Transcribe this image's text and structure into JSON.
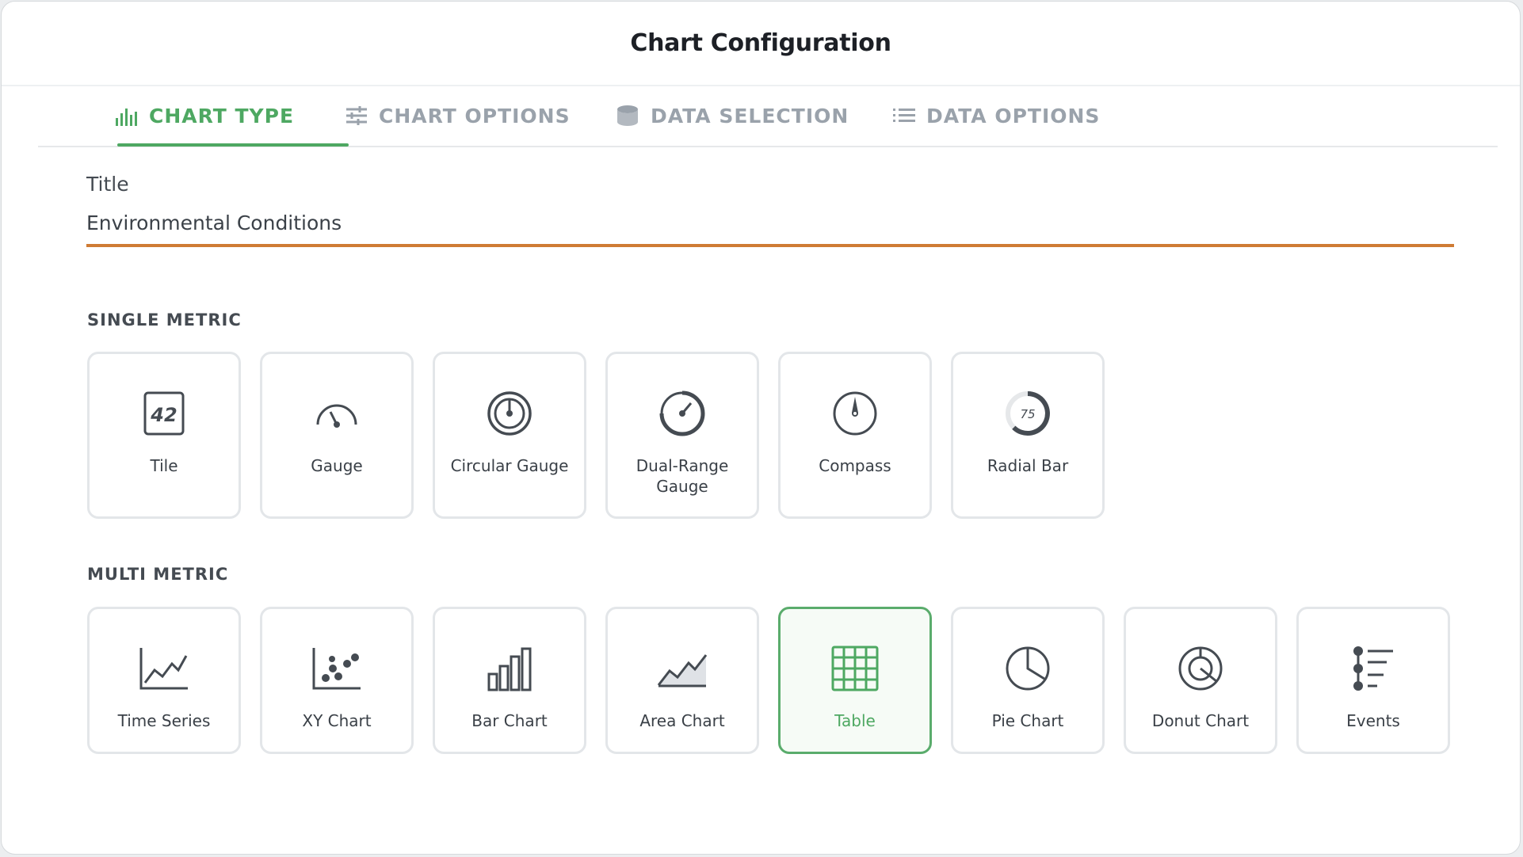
{
  "header": {
    "title": "Chart Configuration"
  },
  "tabs": [
    {
      "label": "CHART TYPE",
      "icon": "bar-chart-icon",
      "active": true
    },
    {
      "label": "CHART OPTIONS",
      "icon": "sliders-icon",
      "active": false
    },
    {
      "label": "DATA SELECTION",
      "icon": "database-icon",
      "active": false
    },
    {
      "label": "DATA OPTIONS",
      "icon": "list-icon",
      "active": false
    }
  ],
  "title_field": {
    "label": "Title",
    "value": "Environmental Conditions"
  },
  "single_metric": {
    "heading": "SINGLE METRIC",
    "cards": [
      {
        "label": "Tile",
        "icon": "tile-icon",
        "tile_value": "42"
      },
      {
        "label": "Gauge",
        "icon": "gauge-icon"
      },
      {
        "label": "Circular Gauge",
        "icon": "circular-gauge-icon"
      },
      {
        "label": "Dual-Range Gauge",
        "icon": "dual-range-gauge-icon"
      },
      {
        "label": "Compass",
        "icon": "compass-icon"
      },
      {
        "label": "Radial Bar",
        "icon": "radial-bar-icon",
        "radial_value": "75"
      }
    ]
  },
  "multi_metric": {
    "heading": "MULTI METRIC",
    "cards": [
      {
        "label": "Time Series",
        "icon": "time-series-icon"
      },
      {
        "label": "XY Chart",
        "icon": "xy-chart-icon"
      },
      {
        "label": "Bar Chart",
        "icon": "bar-chart-icon"
      },
      {
        "label": "Area Chart",
        "icon": "area-chart-icon"
      },
      {
        "label": "Table",
        "icon": "table-icon",
        "selected": true
      },
      {
        "label": "Pie Chart",
        "icon": "pie-chart-icon"
      },
      {
        "label": "Donut Chart",
        "icon": "donut-chart-icon"
      },
      {
        "label": "Events",
        "icon": "events-icon"
      }
    ]
  },
  "colors": {
    "accent": "#4ea862",
    "input_underline": "#cf7b34",
    "icon": "#454b52",
    "muted": "#9aa2ab"
  }
}
